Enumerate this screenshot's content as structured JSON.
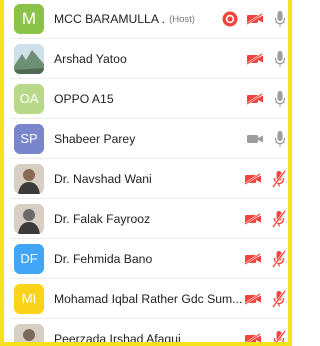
{
  "participants": [
    {
      "name": "MCC BARAMULLA .",
      "host_label": "(Host)",
      "avatar_text": "M",
      "avatar_color": "#8bc34a",
      "avatar_kind": "initials",
      "recording": true,
      "camera": "off",
      "mic": "muted-gray"
    },
    {
      "name": "Arshad Yatoo",
      "host_label": "",
      "avatar_text": "",
      "avatar_color": "#6d8f73",
      "avatar_kind": "photo-landscape",
      "recording": false,
      "camera": "off",
      "mic": "muted-gray"
    },
    {
      "name": "OPPO A15",
      "host_label": "",
      "avatar_text": "OA",
      "avatar_color": "#b9d98a",
      "avatar_kind": "initials",
      "recording": false,
      "camera": "off",
      "mic": "muted-gray"
    },
    {
      "name": "Shabeer Parey",
      "host_label": "",
      "avatar_text": "SP",
      "avatar_color": "#7986cb",
      "avatar_kind": "initials",
      "recording": false,
      "camera": "on-gray",
      "mic": "muted-gray"
    },
    {
      "name": "Dr.  Navshad Wani",
      "host_label": "",
      "avatar_text": "",
      "avatar_color": "#8a6a55",
      "avatar_kind": "photo-person",
      "recording": false,
      "camera": "off",
      "mic": "muted-red"
    },
    {
      "name": "Dr. Falak Fayrooz",
      "host_label": "",
      "avatar_text": "",
      "avatar_color": "#6b6b6b",
      "avatar_kind": "photo-person",
      "recording": false,
      "camera": "off",
      "mic": "muted-red"
    },
    {
      "name": "Dr. Fehmida Bano",
      "host_label": "",
      "avatar_text": "DF",
      "avatar_color": "#42a5f5",
      "avatar_kind": "initials",
      "recording": false,
      "camera": "off",
      "mic": "muted-red"
    },
    {
      "name": "Mohamad Iqbal Rather Gdc Sum...",
      "host_label": "",
      "avatar_text": "MI",
      "avatar_color": "#fbd31b",
      "avatar_kind": "initials",
      "recording": false,
      "camera": "off",
      "mic": "muted-red"
    },
    {
      "name": "Peerzada Irshad Afaqui",
      "host_label": "",
      "avatar_text": "",
      "avatar_color": "#7a6a5a",
      "avatar_kind": "photo-person",
      "recording": false,
      "camera": "off",
      "mic": "muted-red"
    }
  ],
  "colors": {
    "accent_border": "#f6e21b",
    "red": "#f4433c",
    "gray_icon": "#9e9e9e"
  }
}
